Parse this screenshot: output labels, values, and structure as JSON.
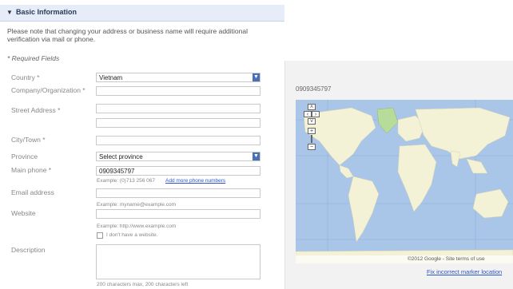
{
  "section": {
    "title": "Basic Information"
  },
  "note": "Please note that changing your address or business name will require additional verification via mail or phone.",
  "required_fields": "* Required Fields",
  "form": {
    "country": {
      "label": "Country *",
      "value": "Vietnam"
    },
    "company": {
      "label": "Company/Organization *",
      "value": ""
    },
    "street": {
      "label": "Street Address *",
      "value": ""
    },
    "street2": {
      "value": ""
    },
    "city": {
      "label": "City/Town *",
      "value": ""
    },
    "province": {
      "label": "Province",
      "value": "Select province"
    },
    "main_phone": {
      "label": "Main phone *",
      "value": "0909345797",
      "hint": "Example: (0)713 256 067",
      "add_link": "Add more phone numbers"
    },
    "email": {
      "label": "Email address",
      "value": "",
      "hint": "Example: myname@example.com"
    },
    "website": {
      "label": "Website",
      "value": "",
      "hint": "Example: http://www.example.com",
      "no_website_label": "I don't have a website."
    },
    "description": {
      "label": "Description",
      "value": "",
      "hint": "200 characters max, 200 characters left"
    }
  },
  "map": {
    "phone_display": "0909345797",
    "zoom_in": "+",
    "zoom_out": "−",
    "pan_left": "‹",
    "pan_right": "›",
    "pan_up": "˄",
    "pan_down": "˅",
    "copyright": "©2012 Google - Site terms of use",
    "incorrect_link": "Fix incorrect marker location"
  },
  "colors": {
    "header_bg": "#e6ecf8",
    "link": "#2a56c6",
    "ocean": "#a9c5e8",
    "land": "#f3f1d6",
    "greenland": "#b7dc9a"
  }
}
